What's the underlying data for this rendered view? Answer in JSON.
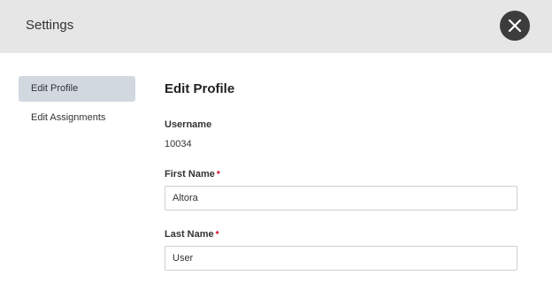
{
  "header": {
    "title": "Settings",
    "close_icon": "close-icon"
  },
  "sidebar": {
    "items": [
      {
        "label": "Edit Profile",
        "active": true
      },
      {
        "label": "Edit Assignments",
        "active": false
      }
    ]
  },
  "main": {
    "title": "Edit Profile",
    "username": {
      "label": "Username",
      "value": "10034"
    },
    "first_name": {
      "label": "First Name",
      "required_mark": "*",
      "value": "Altora"
    },
    "last_name": {
      "label": "Last Name",
      "required_mark": "*",
      "value": "User"
    }
  },
  "colors": {
    "header_bg": "#e6e6e6",
    "active_item_bg": "#d1d8e0",
    "close_button_bg": "#3c3c3c",
    "required": "#d0021b"
  }
}
